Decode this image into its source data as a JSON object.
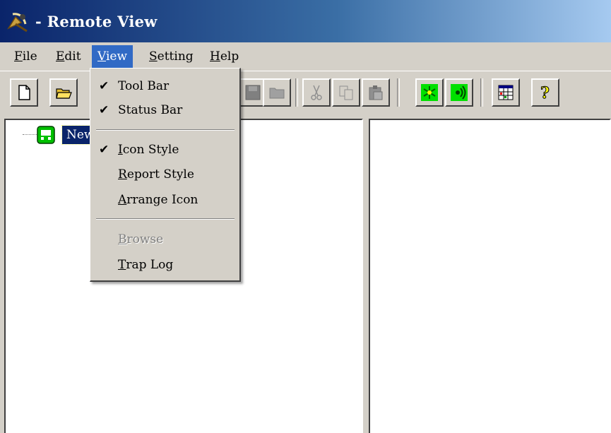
{
  "window": {
    "title": "- Remote View",
    "icon": "satellite-dish-icon"
  },
  "menubar": [
    {
      "key": "F",
      "rest": "ile"
    },
    {
      "key": "E",
      "rest": "dit"
    },
    {
      "key": "V",
      "rest": "iew"
    },
    {
      "key": "S",
      "rest": "etting"
    },
    {
      "key": "H",
      "rest": "elp"
    }
  ],
  "toolbar": {
    "buttons": [
      "new-document-icon",
      "open-folder-icon",
      "save-icon",
      "folder-icon",
      "cut-icon",
      "copy-icon",
      "paste-icon",
      "green-snowflake-icon",
      "green-signal-icon",
      "table-grid-icon",
      "help-question-icon"
    ]
  },
  "tree": {
    "root_label": "New"
  },
  "view_menu": {
    "items": [
      {
        "check": "✔",
        "key": "",
        "rest": "Tool Bar"
      },
      {
        "check": "✔",
        "key": "",
        "rest": "Status Bar"
      },
      {
        "check": "✔",
        "key": "I",
        "rest": "con Style"
      },
      {
        "check": "",
        "key": "R",
        "rest": "eport Style"
      },
      {
        "check": "",
        "key": "A",
        "rest": "rrange Icon"
      },
      {
        "check": "",
        "key": "B",
        "rest": "rowse",
        "disabled": true
      },
      {
        "check": "",
        "key": "T",
        "rest": "rap Log"
      }
    ]
  },
  "colors": {
    "title_start": "#0a246a",
    "title_end": "#a6caf0",
    "menu_highlight": "#316ac5",
    "selection": "#0a246a",
    "face": "#d4d0c8"
  }
}
